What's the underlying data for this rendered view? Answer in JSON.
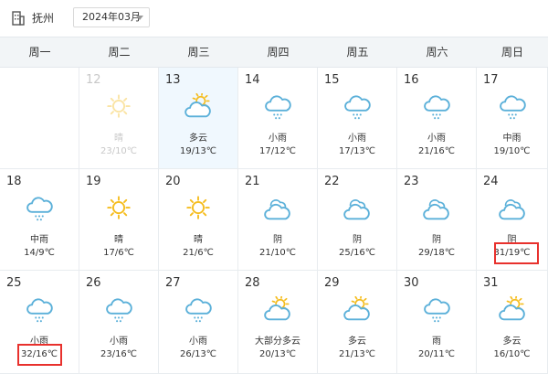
{
  "topbar": {
    "city": "抚州",
    "month": "2024年03月",
    "building_icon": "building-icon"
  },
  "weekdays": [
    "周一",
    "周二",
    "周三",
    "周四",
    "周五",
    "周六",
    "周日"
  ],
  "colors": {
    "sun": "#f5bd1f",
    "cloud": "#5bb0d9",
    "highlight": "#e8312d",
    "header_bg": "#f2f5f7",
    "today_bg": "#f0f8fe"
  },
  "days": [
    {
      "num": "12",
      "cond": "晴",
      "temp": "23/10℃",
      "icon": "sun",
      "state": "past"
    },
    {
      "num": "13",
      "cond": "多云",
      "temp": "19/13℃",
      "icon": "partly-cloudy",
      "state": "today"
    },
    {
      "num": "14",
      "cond": "小雨",
      "temp": "17/12℃",
      "icon": "rain",
      "state": "normal"
    },
    {
      "num": "15",
      "cond": "小雨",
      "temp": "17/13℃",
      "icon": "rain",
      "state": "normal"
    },
    {
      "num": "16",
      "cond": "小雨",
      "temp": "21/16℃",
      "icon": "rain",
      "state": "normal"
    },
    {
      "num": "17",
      "cond": "中雨",
      "temp": "19/10℃",
      "icon": "rain",
      "state": "normal"
    },
    {
      "num": "18",
      "cond": "中雨",
      "temp": "14/9℃",
      "icon": "rain",
      "state": "normal"
    },
    {
      "num": "19",
      "cond": "晴",
      "temp": "17/6℃",
      "icon": "sun",
      "state": "normal"
    },
    {
      "num": "20",
      "cond": "晴",
      "temp": "21/6℃",
      "icon": "sun",
      "state": "normal"
    },
    {
      "num": "21",
      "cond": "阴",
      "temp": "21/10℃",
      "icon": "overcast",
      "state": "normal"
    },
    {
      "num": "22",
      "cond": "阴",
      "temp": "25/16℃",
      "icon": "overcast",
      "state": "normal"
    },
    {
      "num": "23",
      "cond": "阴",
      "temp": "29/18℃",
      "icon": "overcast",
      "state": "normal"
    },
    {
      "num": "24",
      "cond": "阴",
      "temp": "31/19℃",
      "icon": "overcast",
      "state": "highlight"
    },
    {
      "num": "25",
      "cond": "小雨",
      "temp": "32/16℃",
      "icon": "rain",
      "state": "highlight"
    },
    {
      "num": "26",
      "cond": "小雨",
      "temp": "23/16℃",
      "icon": "rain",
      "state": "normal"
    },
    {
      "num": "27",
      "cond": "小雨",
      "temp": "26/13℃",
      "icon": "rain",
      "state": "normal"
    },
    {
      "num": "28",
      "cond": "大部分多云",
      "temp": "20/13℃",
      "icon": "partly-cloudy",
      "state": "normal"
    },
    {
      "num": "29",
      "cond": "多云",
      "temp": "21/13℃",
      "icon": "partly-cloudy",
      "state": "normal"
    },
    {
      "num": "30",
      "cond": "雨",
      "temp": "20/11℃",
      "icon": "rain",
      "state": "normal"
    },
    {
      "num": "31",
      "cond": "多云",
      "temp": "16/10℃",
      "icon": "partly-cloudy",
      "state": "normal"
    }
  ]
}
